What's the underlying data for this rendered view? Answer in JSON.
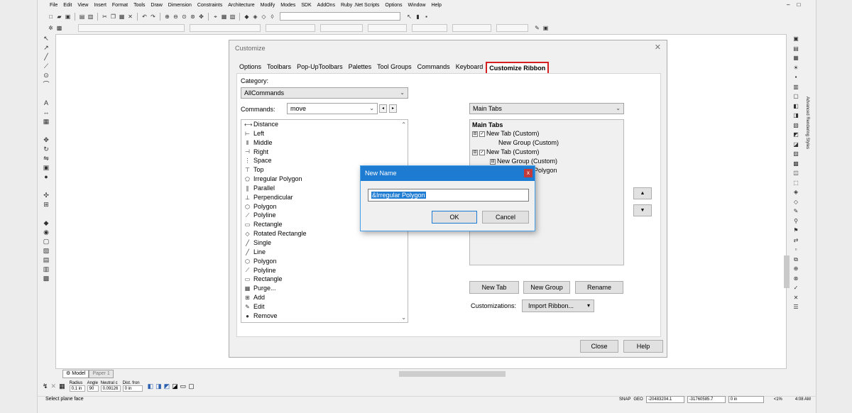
{
  "menu": [
    "File",
    "Edit",
    "View",
    "Insert",
    "Format",
    "Tools",
    "Draw",
    "Dimension",
    "Constraints",
    "Architecture",
    "Modify",
    "Modes",
    "SDK",
    "AddOns",
    "Ruby .Net Scripts",
    "Options",
    "Window",
    "Help"
  ],
  "window_controls": [
    "–",
    "□"
  ],
  "right_toolbar_label": "Advanced Rendering Styles",
  "customize": {
    "title": "Customize",
    "tabs": [
      "Options",
      "Toolbars",
      "Pop-UpToolbars",
      "Palettes",
      "Tool Groups",
      "Commands",
      "Keyboard",
      "Customize Ribbon"
    ],
    "active_tab": "Customize Ribbon",
    "category_label": "Category:",
    "category_value": "AllCommands",
    "commands_label": "Commands:",
    "commands_value": "move",
    "commands": [
      {
        "label": "Distance",
        "icon": "distance-icon"
      },
      {
        "label": "Left",
        "icon": "align-left-icon"
      },
      {
        "label": "Middle",
        "icon": "align-middle-icon"
      },
      {
        "label": "Right",
        "icon": "align-right-icon"
      },
      {
        "label": "Space",
        "icon": "space-icon"
      },
      {
        "label": "Top",
        "icon": "align-top-icon"
      },
      {
        "label": "Irregular Polygon",
        "icon": "irregular-polygon-icon"
      },
      {
        "label": "Parallel",
        "icon": "parallel-icon"
      },
      {
        "label": "Perpendicular",
        "icon": "perpendicular-icon"
      },
      {
        "label": "Polygon",
        "icon": "polygon-icon"
      },
      {
        "label": "Polyline",
        "icon": "polyline-icon"
      },
      {
        "label": "Rectangle",
        "icon": "rectangle-icon"
      },
      {
        "label": "Rotated Rectangle",
        "icon": "rotated-rectangle-icon"
      },
      {
        "label": "Single",
        "icon": "single-icon"
      },
      {
        "label": "Line",
        "icon": "line-icon"
      },
      {
        "label": "Polygon",
        "icon": "polygon-icon"
      },
      {
        "label": "Polyline",
        "icon": "polyline-icon"
      },
      {
        "label": "Rectangle",
        "icon": "rectangle-icon"
      },
      {
        "label": "Purge...",
        "icon": "purge-icon"
      },
      {
        "label": "Add",
        "icon": "add-icon"
      },
      {
        "label": "Edit",
        "icon": "edit-icon"
      },
      {
        "label": "Remove",
        "icon": "remove-icon"
      }
    ],
    "tabs_combo_value": "Main Tabs",
    "tree": {
      "root": "Main Tabs",
      "items": [
        {
          "label": "New Tab (Custom)",
          "box": "⊟",
          "checked": true
        },
        {
          "label": "New Group (Custom)"
        },
        {
          "label": "New Tab (Custom)",
          "box": "⊟",
          "checked": true
        },
        {
          "label": "New Group (Custom)",
          "box": "⊟"
        },
        {
          "label": "Irregular Polygon"
        }
      ]
    },
    "new_tab_button": "New Tab",
    "new_group_button": "New Group",
    "rename_button": "Rename",
    "customizations_label": "Customizations:",
    "import_button": "Import Ribbon...",
    "close_button": "Close",
    "help_button": "Help"
  },
  "new_name_dialog": {
    "title": "New Name",
    "value": "&Irregular Polygon",
    "ok": "OK",
    "cancel": "Cancel",
    "close": "x"
  },
  "sheet_tabs": [
    "Model",
    "Paper 1"
  ],
  "snap_fields": [
    {
      "label": "Radius",
      "value": "0.1 in"
    },
    {
      "label": "Angle",
      "value": "90"
    },
    {
      "label": "Neutral c",
      "value": "0.09126"
    },
    {
      "label": "Dist. fron",
      "value": "0 in"
    }
  ],
  "status": {
    "message": "Select plane face",
    "snap": "SNAP",
    "geo": "GEO",
    "x": "-20483204.1",
    "y": "-31760585.7",
    "z": "0 in",
    "zoom": "<1%",
    "time": "4:08 AM"
  }
}
